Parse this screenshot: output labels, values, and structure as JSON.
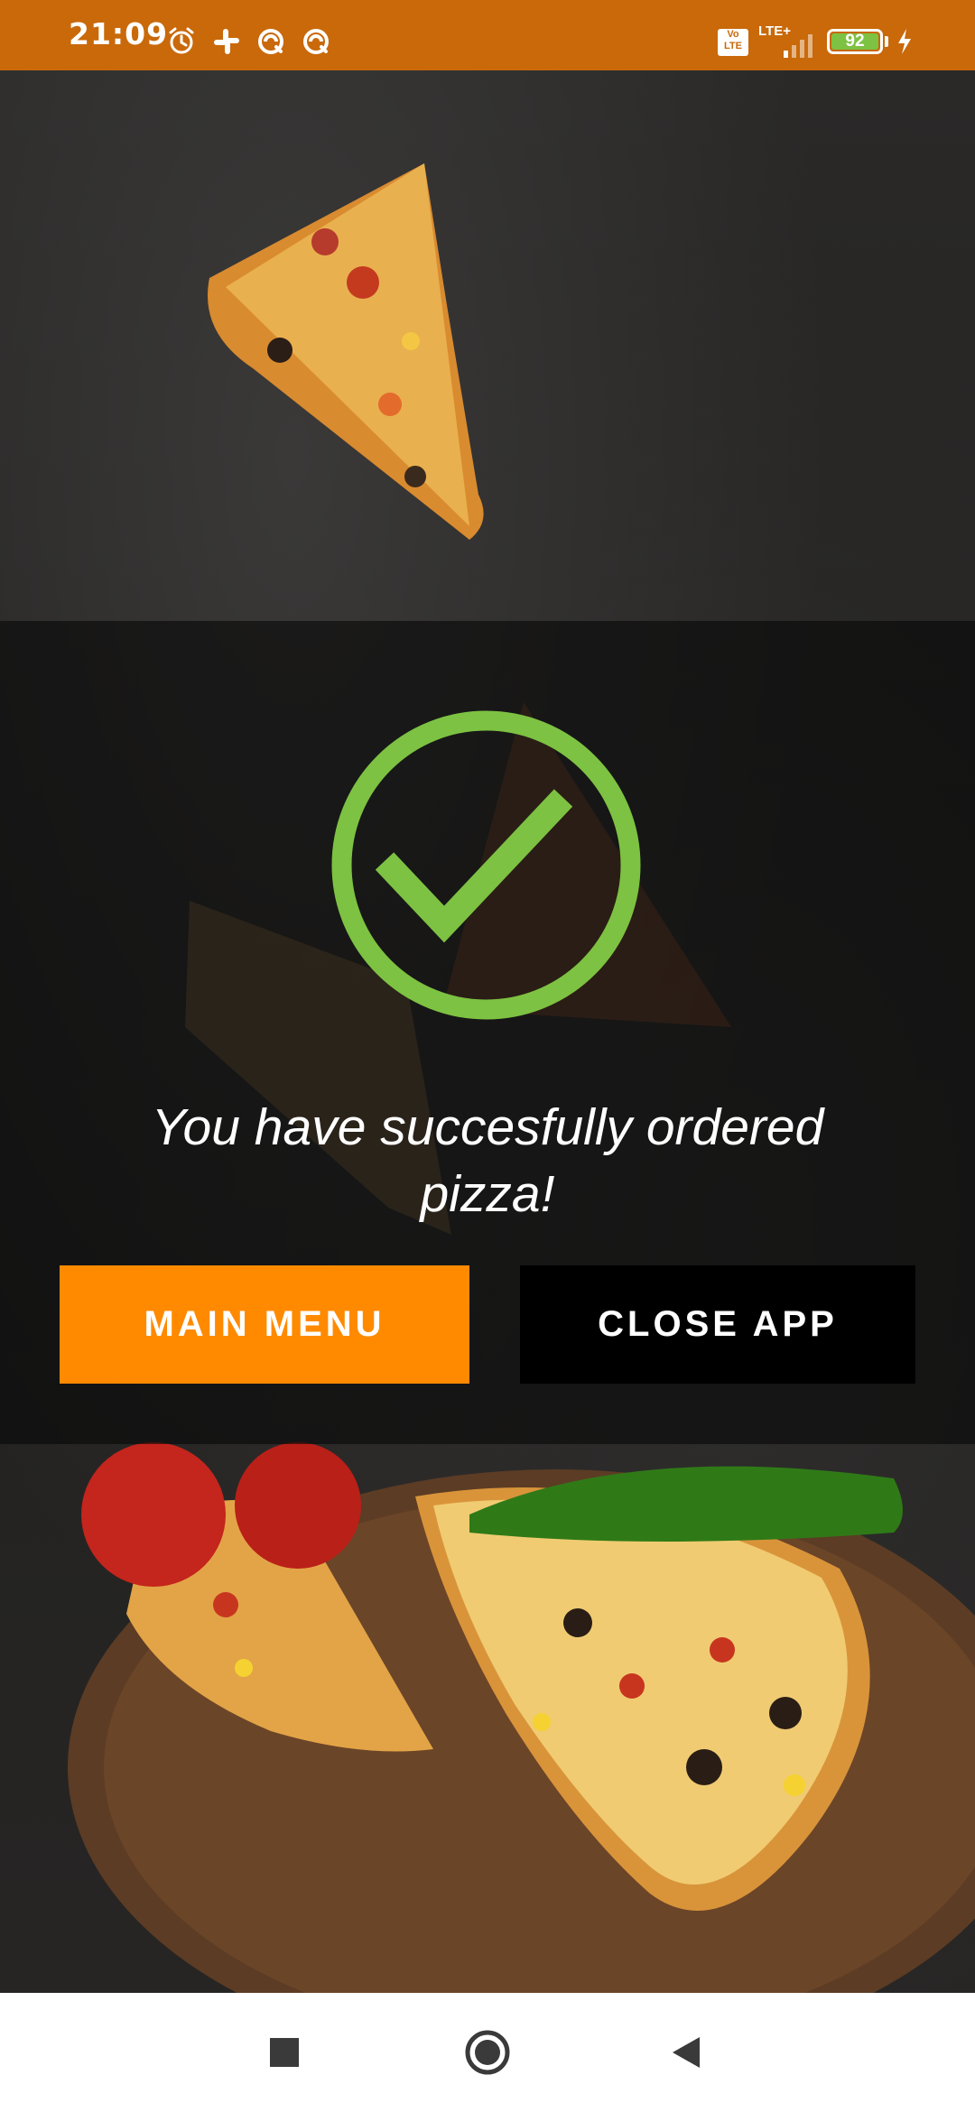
{
  "status_bar": {
    "time": "21:09",
    "volte_label": "Vo\nLTE",
    "network_label": "LTE+",
    "battery_level": 92,
    "battery_text": "92",
    "icons": [
      "alarm-icon",
      "slack-icon",
      "notification-icon",
      "notification-icon"
    ]
  },
  "confirmation": {
    "message": "You have succesfully ordered pizza!",
    "icon": "check-circle-icon",
    "icon_color": "#7dc242"
  },
  "actions": {
    "main_menu_label": "MAIN MENU",
    "close_app_label": "CLOSE APP",
    "main_menu_color": "#ff8a00",
    "close_app_color": "#000000"
  },
  "navigation": {
    "recents": "recents-icon",
    "home": "home-icon",
    "back": "back-icon"
  }
}
